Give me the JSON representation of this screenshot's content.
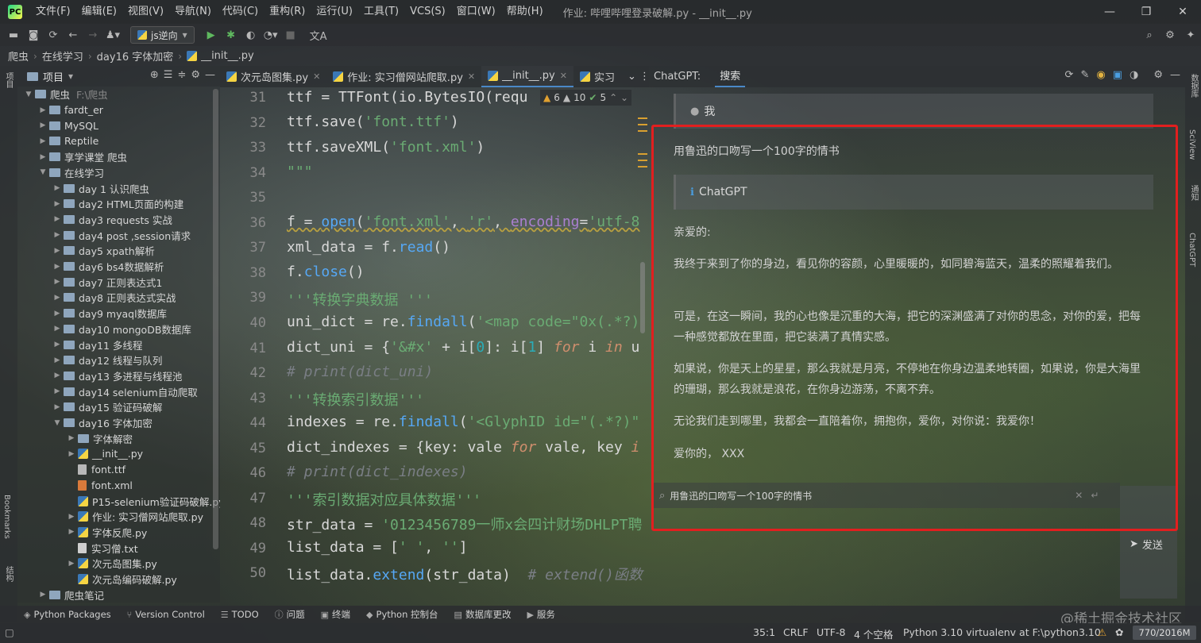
{
  "titlebar": {
    "menus": [
      "文件(F)",
      "编辑(E)",
      "视图(V)",
      "导航(N)",
      "代码(C)",
      "重构(R)",
      "运行(U)",
      "工具(T)",
      "VCS(S)",
      "窗口(W)",
      "帮助(H)"
    ],
    "window_title": "作业: 哔哩哔哩登录破解.py - __init__.py"
  },
  "toolbar": {
    "run_config": "js逆向"
  },
  "breadcrumb": [
    "爬虫",
    "在线学习",
    "day16 字体加密",
    "__init__.py"
  ],
  "left_strip": {
    "project": "项目",
    "bookmarks": "Bookmarks",
    "structure": "结构"
  },
  "project": {
    "title": "项目",
    "tree": [
      {
        "label": "爬虫",
        "indent": 0,
        "type": "folder",
        "open": true,
        "suffix": "F:\\爬虫"
      },
      {
        "label": "fardt_er",
        "indent": 1,
        "type": "folder"
      },
      {
        "label": "MySQL",
        "indent": 1,
        "type": "folder"
      },
      {
        "label": "Reptile",
        "indent": 1,
        "type": "folder"
      },
      {
        "label": "享学课堂 爬虫",
        "indent": 1,
        "type": "folder"
      },
      {
        "label": "在线学习",
        "indent": 1,
        "type": "folder",
        "open": true
      },
      {
        "label": "day 1 认识爬虫",
        "indent": 2,
        "type": "folder"
      },
      {
        "label": "day2 HTML页面的构建",
        "indent": 2,
        "type": "folder"
      },
      {
        "label": "day3 requests 实战",
        "indent": 2,
        "type": "folder"
      },
      {
        "label": "day4 post ,session请求",
        "indent": 2,
        "type": "folder"
      },
      {
        "label": "day5 xpath解析",
        "indent": 2,
        "type": "folder"
      },
      {
        "label": "day6 bs4数据解析",
        "indent": 2,
        "type": "folder"
      },
      {
        "label": "day7 正则表达式1",
        "indent": 2,
        "type": "folder"
      },
      {
        "label": "day8 正则表达式实战",
        "indent": 2,
        "type": "folder"
      },
      {
        "label": "day9 myaql数据库",
        "indent": 2,
        "type": "folder"
      },
      {
        "label": "day10 mongoDB数据库",
        "indent": 2,
        "type": "folder"
      },
      {
        "label": "day11 多线程",
        "indent": 2,
        "type": "folder"
      },
      {
        "label": "day12 线程与队列",
        "indent": 2,
        "type": "folder"
      },
      {
        "label": "day13 多进程与线程池",
        "indent": 2,
        "type": "folder"
      },
      {
        "label": "day14 selenium自动爬取",
        "indent": 2,
        "type": "folder"
      },
      {
        "label": "day15 验证码破解",
        "indent": 2,
        "type": "folder"
      },
      {
        "label": "day16 字体加密",
        "indent": 2,
        "type": "folder",
        "open": true
      },
      {
        "label": "字体解密",
        "indent": 3,
        "type": "folder"
      },
      {
        "label": "__init__.py",
        "indent": 3,
        "type": "py",
        "arrow": true
      },
      {
        "label": "font.ttf",
        "indent": 3,
        "type": "gen"
      },
      {
        "label": "font.xml",
        "indent": 3,
        "type": "xml"
      },
      {
        "label": "P15-selenium验证码破解.py",
        "indent": 3,
        "type": "py"
      },
      {
        "label": "作业: 实习僧网站爬取.py",
        "indent": 3,
        "type": "py",
        "arrow": true
      },
      {
        "label": "字体反爬.py",
        "indent": 3,
        "type": "py",
        "arrow": true
      },
      {
        "label": "实习僧.txt",
        "indent": 3,
        "type": "txt"
      },
      {
        "label": "次元岛图集.py",
        "indent": 3,
        "type": "py",
        "arrow": true
      },
      {
        "label": "次元岛编码破解.py",
        "indent": 3,
        "type": "py"
      },
      {
        "label": "爬虫笔记",
        "indent": 1,
        "type": "folder"
      }
    ]
  },
  "editor": {
    "tabs": [
      {
        "label": "次元岛图集.py",
        "active": false
      },
      {
        "label": "作业: 实习僧网站爬取.py",
        "active": false
      },
      {
        "label": "__init__.py",
        "active": true
      },
      {
        "label": "实习",
        "active": false
      }
    ],
    "inspections": {
      "warnings": "6",
      "weak": "10",
      "ok": "5"
    },
    "line_numbers": [
      "31",
      "32",
      "33",
      "34",
      "35",
      "36",
      "37",
      "38",
      "39",
      "40",
      "41",
      "42",
      "43",
      "44",
      "45",
      "46",
      "47",
      "48",
      "49",
      "50"
    ]
  },
  "chatgpt": {
    "panel_title": "ChatGPT:",
    "tab": "搜索",
    "user_label": "我",
    "user_message": "用鲁迅的口吻写一个100字的情书",
    "bot_label": "ChatGPT",
    "reply": [
      "亲爱的:",
      "我终于来到了你的身边，看见你的容颜，心里暖暖的，如同碧海蓝天，温柔的照耀着我们。",
      "可是，在这一瞬间，我的心也像是沉重的大海，把它的深渊盛满了对你的思念，对你的爱，把每一种感觉都放在里面，把它装满了真情实感。",
      "如果说，你是天上的星星，那么我就是月亮，不停地在你身边温柔地转圈，如果说，你是大海里的珊瑚，那么我就是浪花，在你身边游荡，不离不弃。",
      "无论我们走到哪里，我都会一直陪着你，拥抱你，爱你，对你说：我爱你！",
      "爱你的， XXX"
    ],
    "input_value": "用鲁迅的口吻写一个100字的情书",
    "send_label": "发送"
  },
  "right_strip": [
    "数据库",
    "SciView",
    "通知",
    "ChatGPT"
  ],
  "bottom_tools": [
    "Python Packages",
    "Version Control",
    "TODO",
    "问题",
    "终端",
    "Python 控制台",
    "数据库更改",
    "服务"
  ],
  "watermark": "@稀土掘金技术社区",
  "status": {
    "position": "35:1",
    "line_sep": "CRLF",
    "encoding": "UTF-8",
    "indent": "4 个空格",
    "interpreter": "Python 3.10 virtualenv at F:\\python3.10",
    "memory": "770/2016M"
  }
}
